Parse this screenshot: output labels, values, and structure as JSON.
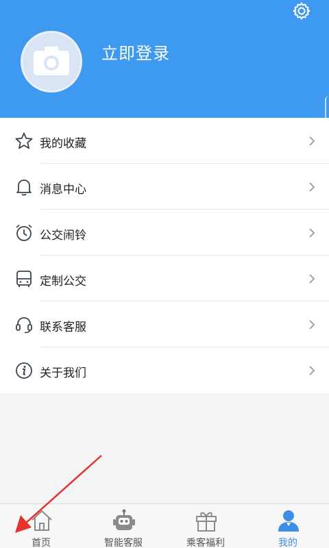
{
  "header": {
    "login_label": "立即登录",
    "accent": "#3d9af0"
  },
  "menu": {
    "items": [
      {
        "label": "我的收藏",
        "icon": "star-icon"
      },
      {
        "label": "消息中心",
        "icon": "bell-icon"
      },
      {
        "label": "公交闹铃",
        "icon": "alarm-clock-icon"
      },
      {
        "label": "定制公交",
        "icon": "bus-icon"
      },
      {
        "label": "联系客服",
        "icon": "headset-icon"
      },
      {
        "label": "关于我们",
        "icon": "info-icon"
      }
    ]
  },
  "tabbar": {
    "tabs": [
      {
        "label": "首页",
        "icon": "home-icon"
      },
      {
        "label": "智能客服",
        "icon": "robot-icon"
      },
      {
        "label": "乘客福利",
        "icon": "gift-icon"
      },
      {
        "label": "我的",
        "icon": "user-icon"
      }
    ],
    "active_color": "#3d8ee8"
  }
}
